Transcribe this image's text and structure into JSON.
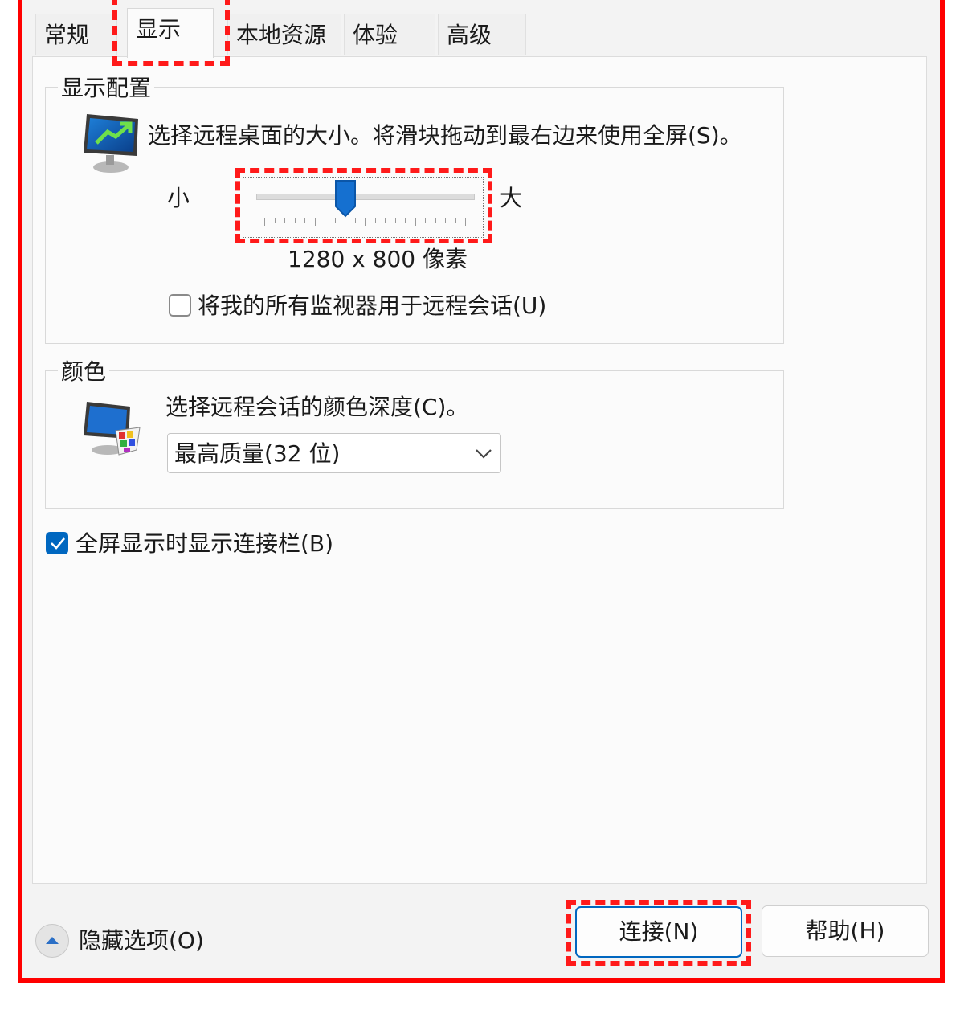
{
  "tabs": [
    {
      "label": "常规",
      "active": false
    },
    {
      "label": "显示",
      "active": true
    },
    {
      "label": "本地资源",
      "active": false
    },
    {
      "label": "体验",
      "active": false
    },
    {
      "label": "高级",
      "active": false
    }
  ],
  "display_config": {
    "legend": "显示配置",
    "description": "选择远程桌面的大小。将滑块拖动到最右边来使用全屏(S)。",
    "slider_min_label": "小",
    "slider_max_label": "大",
    "slider_position": 0.41,
    "resolution": "1280 x 800 像素",
    "multi_monitor_label": "将我的所有监视器用于远程会话(U)",
    "multi_monitor_checked": false
  },
  "color": {
    "legend": "颜色",
    "description": "选择远程会话的颜色深度(C)。",
    "selected_option": "最高质量(32 位)"
  },
  "connection_bar_label": "全屏显示时显示连接栏(B)",
  "connection_bar_checked": true,
  "footer": {
    "hide_options_label": "隐藏选项(O)",
    "connect_label": "连接(N)",
    "help_label": "帮助(H)"
  },
  "colors": {
    "highlight": "#ff0000",
    "accent": "#0067c0"
  }
}
